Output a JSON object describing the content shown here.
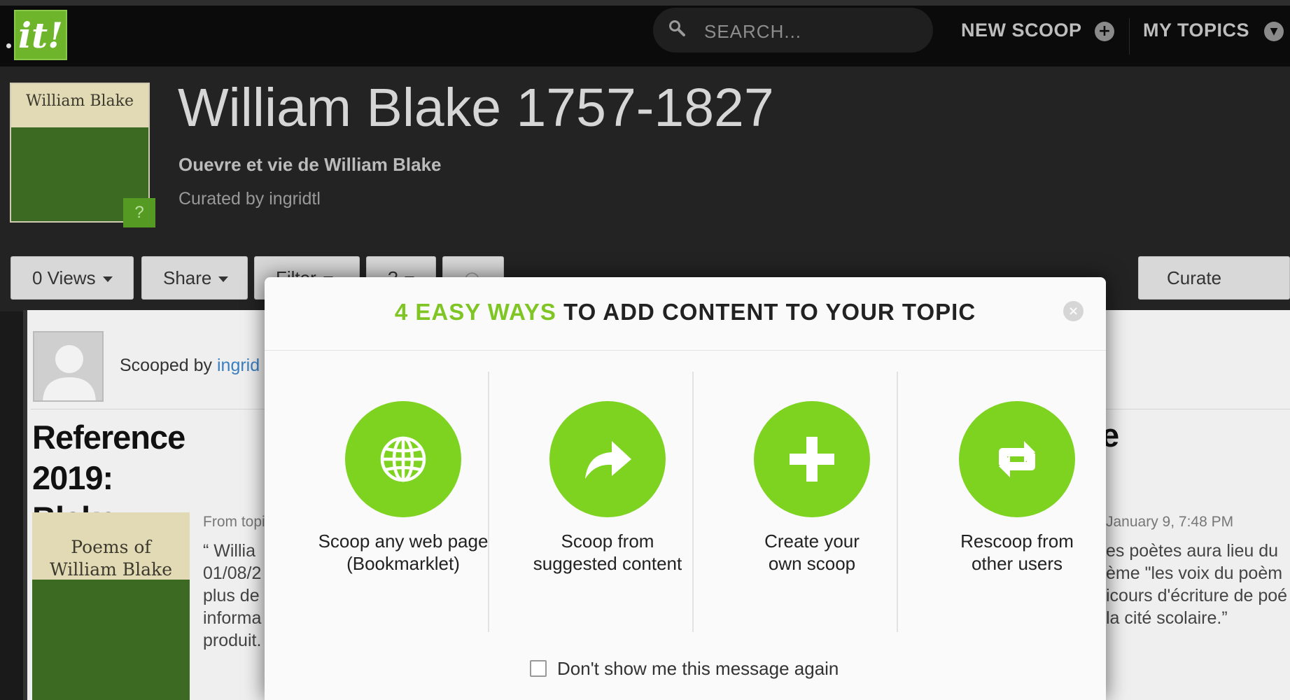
{
  "topbar": {
    "logo_text": "it!",
    "search_placeholder": "SEARCH...",
    "new_scoop": "NEW SCOOP",
    "my_topics": "MY TOPICS"
  },
  "header": {
    "cover_text": "William Blake",
    "cover_help": "?",
    "title": "William Blake 1757-1827",
    "subtitle": "Ouevre et vie de William Blake",
    "curated_by": "Curated by ingridtl"
  },
  "toolbar": {
    "views": "0 Views",
    "share": "Share",
    "filter": "Filter",
    "sort": "?",
    "curate": "Curate"
  },
  "post": {
    "scooped_by_label": "Scooped by",
    "scooped_by_user": "ingrid",
    "title_lines": [
      "Reference 2019:",
      "Blake"
    ],
    "title_right_fragment": "e",
    "book_line1": "Poems of",
    "book_line2": "William Blake",
    "from_label": "From topi",
    "left_excerpt": "“ Willia\n01/08/2\nplus de\ninforma\nproduit.",
    "date": "January 9, 7:48 PM",
    "right_excerpt": "es poètes aura lieu du\nème \"les voix du poèm\nicours d'écriture de poé\nla cité scolaire.”"
  },
  "modal": {
    "title_accent": "4 EASY WAYS",
    "title_rest": "TO ADD CONTENT TO YOUR TOPIC",
    "options": [
      {
        "line1": "Scoop any web page",
        "line2": "(Bookmarklet)",
        "icon": "globe-icon"
      },
      {
        "line1": "Scoop from",
        "line2": "suggested content",
        "icon": "share-arrow-icon"
      },
      {
        "line1": "Create your",
        "line2": "own scoop",
        "icon": "plus-icon"
      },
      {
        "line1": "Rescoop from",
        "line2": "other users",
        "icon": "rescoop-icon"
      }
    ],
    "dont_show": "Don't show me this message again",
    "accent_color": "#7ed321"
  }
}
